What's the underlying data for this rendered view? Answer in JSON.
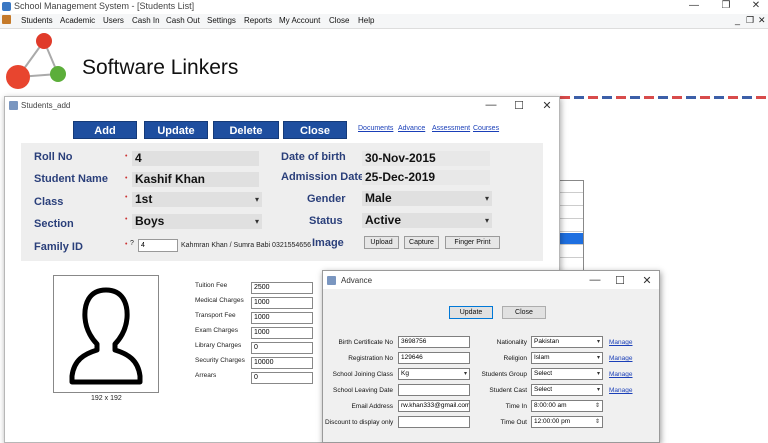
{
  "main_window": {
    "title": "School Management System - [Students List]",
    "controls": {
      "minimize": "—",
      "maximize": "❐",
      "close": "✕"
    },
    "mdi_controls": {
      "minimize": "_",
      "restore": "❐",
      "close": "✕"
    }
  },
  "menu": [
    "Students",
    "Academic",
    "Users",
    "Cash In",
    "Cash Out",
    "Settings",
    "Reports",
    "My Account",
    "Close",
    "Help"
  ],
  "brand": {
    "name": "Software Linkers"
  },
  "students_add": {
    "title": "Students_add",
    "controls": {
      "minimize": "—",
      "maximize": "☐",
      "close": "✕"
    },
    "buttons": {
      "add": "Add",
      "update": "Update",
      "delete": "Delete",
      "close": "Close"
    },
    "links": {
      "documents": "Documents",
      "advance": "Advance",
      "assessment": "Assessment",
      "courses": "Courses"
    },
    "fields": {
      "roll_no": {
        "label": "Roll No",
        "value": "4"
      },
      "student_name": {
        "label": "Student Name",
        "value": "Kashif Khan"
      },
      "class": {
        "label": "Class",
        "value": "1st"
      },
      "section": {
        "label": "Section",
        "value": "Boys"
      },
      "family_id": {
        "label": "Family ID",
        "prefix": "?",
        "value": "4",
        "family_text": "Kahmran Khan / Sumra Babi 0321554656"
      },
      "date_of_birth": {
        "label": "Date of birth",
        "value": "30-Nov-2015"
      },
      "admission_date": {
        "label": "Admission Date",
        "value": "25-Dec-2019"
      },
      "gender": {
        "label": "Gender",
        "value": "Male"
      },
      "status": {
        "label": "Status",
        "value": "Active"
      },
      "image": {
        "label": "Image"
      }
    },
    "image_buttons": {
      "upload": "Upload",
      "capture": "Capture",
      "finger_print": "Finger Print"
    },
    "photo_caption": "192 x 192",
    "fees": [
      {
        "label": "Tuition Fee",
        "value": "2500"
      },
      {
        "label": "Medical Charges",
        "value": "1000"
      },
      {
        "label": "Transport Fee",
        "value": "1000"
      },
      {
        "label": "Exam Charges",
        "value": "1000"
      },
      {
        "label": "Library Charges",
        "value": "0"
      },
      {
        "label": "Security Charges",
        "value": "10000"
      },
      {
        "label": "Arrears",
        "value": "0"
      }
    ]
  },
  "advance": {
    "title": "Advance",
    "controls": {
      "minimize": "—",
      "maximize": "☐",
      "close": "✕"
    },
    "buttons": {
      "update": "Update",
      "close": "Close"
    },
    "left_fields": [
      {
        "label": "Birth Certificate No",
        "value": "3698756"
      },
      {
        "label": "Registration No",
        "value": "129646"
      },
      {
        "label": "School Joining Class",
        "value": "Kg"
      },
      {
        "label": "School Leaving Date",
        "value": ""
      },
      {
        "label": "Email Address",
        "value": "rw.khan333@gmail.com"
      },
      {
        "label": "Discount to display only",
        "value": ""
      }
    ],
    "right_fields": [
      {
        "label": "Nationality",
        "value": "Pakistan"
      },
      {
        "label": "Religion",
        "value": "Islam"
      },
      {
        "label": "Students Group",
        "value": "Select"
      },
      {
        "label": "Student Cast",
        "value": "Select"
      },
      {
        "label": "Time In",
        "value": "8:00:00 am"
      },
      {
        "label": "Time Out",
        "value": "12:00:00 pm"
      }
    ],
    "manage_label": "Manage"
  }
}
